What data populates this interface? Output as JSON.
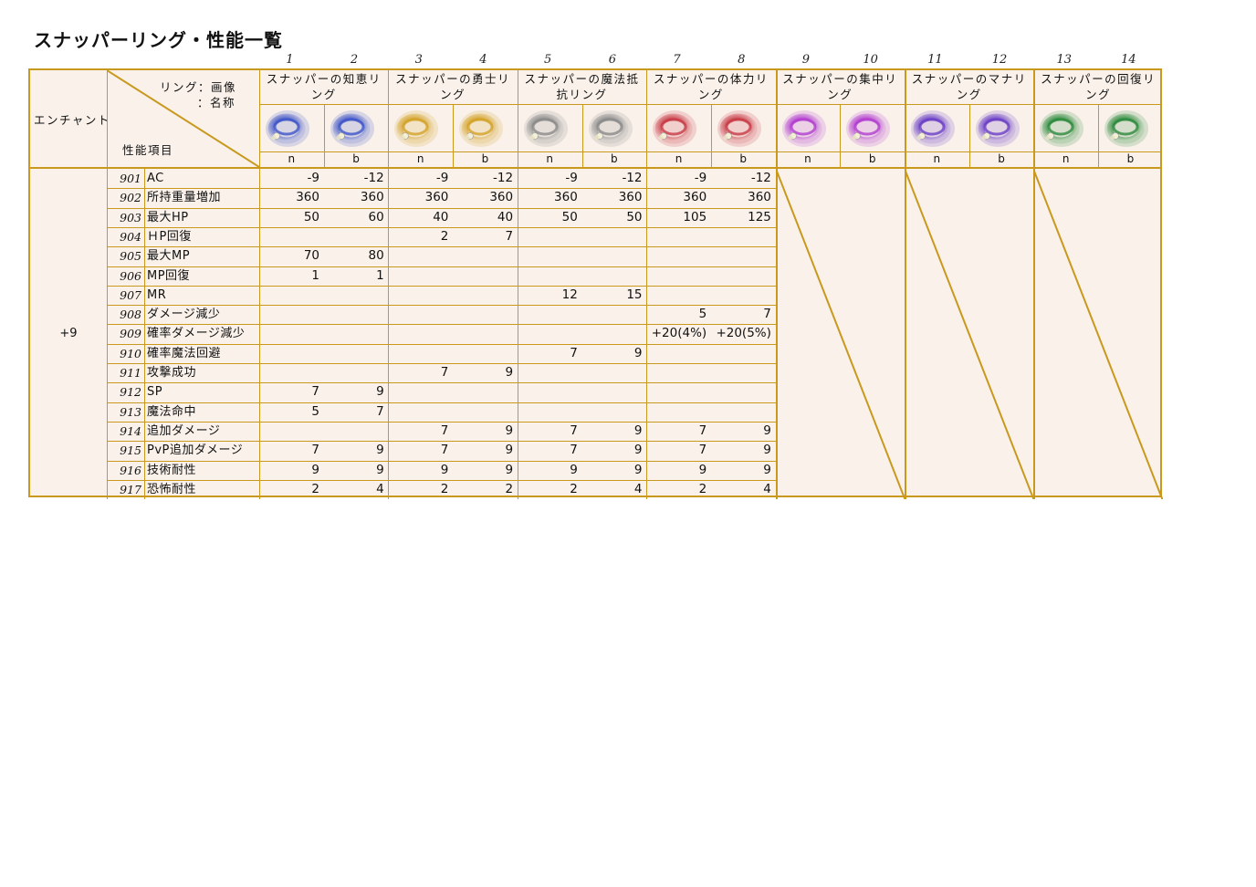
{
  "title": "スナッパーリング・性能一覧",
  "column_numbers": [
    "1",
    "2",
    "3",
    "4",
    "5",
    "6",
    "7",
    "8",
    "9",
    "10",
    "11",
    "12",
    "13",
    "14"
  ],
  "header": {
    "enchant_label": "エンチャント",
    "ring_label": "リング：画像",
    "name_label": "：名称",
    "item_label": "性能項目"
  },
  "rings": [
    {
      "name": "スナッパーの知恵リング",
      "color": "#3f55c8",
      "variants": [
        "n",
        "b"
      ]
    },
    {
      "name": "スナッパーの勇士リング",
      "color": "#d3a227",
      "variants": [
        "n",
        "b"
      ]
    },
    {
      "name": "スナッパーの魔法抵抗リング",
      "color": "#8a8a8a",
      "variants": [
        "n",
        "b"
      ]
    },
    {
      "name": "スナッパーの体力リング",
      "color": "#c83a46",
      "variants": [
        "n",
        "b"
      ]
    },
    {
      "name": "スナッパーの集中リング",
      "color": "#b23dd0",
      "variants": [
        "n",
        "b"
      ]
    },
    {
      "name": "スナッパーのマナリング",
      "color": "#6a3fc6",
      "variants": [
        "n",
        "b"
      ]
    },
    {
      "name": "スナッパーの回復リング",
      "color": "#2c8a3c",
      "variants": [
        "n",
        "b"
      ]
    }
  ],
  "enchant_value": "+9",
  "rows": [
    {
      "id": "901",
      "label": "AC",
      "values": [
        "-9",
        "-12",
        "-9",
        "-12",
        "-9",
        "-12",
        "-9",
        "-12"
      ]
    },
    {
      "id": "902",
      "label": "所持重量増加",
      "values": [
        "360",
        "360",
        "360",
        "360",
        "360",
        "360",
        "360",
        "360"
      ]
    },
    {
      "id": "903",
      "label": "最大HP",
      "values": [
        "50",
        "60",
        "40",
        "40",
        "50",
        "50",
        "105",
        "125"
      ]
    },
    {
      "id": "904",
      "label": "ＨP回復",
      "values": [
        "",
        "",
        "2",
        "7",
        "",
        "",
        "",
        ""
      ]
    },
    {
      "id": "905",
      "label": "最大MP",
      "values": [
        "70",
        "80",
        "",
        "",
        "",
        "",
        "",
        ""
      ]
    },
    {
      "id": "906",
      "label": "MP回復",
      "values": [
        "1",
        "1",
        "",
        "",
        "",
        "",
        "",
        ""
      ]
    },
    {
      "id": "907",
      "label": "MR",
      "values": [
        "",
        "",
        "",
        "",
        "12",
        "15",
        "",
        ""
      ]
    },
    {
      "id": "908",
      "label": "ダメージ減少",
      "values": [
        "",
        "",
        "",
        "",
        "",
        "",
        "5",
        "7"
      ]
    },
    {
      "id": "909",
      "label": "確率ダメージ減少",
      "values": [
        "",
        "",
        "",
        "",
        "",
        "",
        "+20(4%)",
        "+20(5%)"
      ]
    },
    {
      "id": "910",
      "label": "確率魔法回避",
      "values": [
        "",
        "",
        "",
        "",
        "7",
        "9",
        "",
        ""
      ]
    },
    {
      "id": "911",
      "label": "攻撃成功",
      "values": [
        "",
        "",
        "7",
        "9",
        "",
        "",
        "",
        ""
      ]
    },
    {
      "id": "912",
      "label": "SP",
      "values": [
        "7",
        "9",
        "",
        "",
        "",
        "",
        "",
        ""
      ]
    },
    {
      "id": "913",
      "label": "魔法命中",
      "values": [
        "5",
        "7",
        "",
        "",
        "",
        "",
        "",
        ""
      ]
    },
    {
      "id": "914",
      "label": "追加ダメージ",
      "values": [
        "",
        "",
        "7",
        "9",
        "7",
        "9",
        "7",
        "9"
      ]
    },
    {
      "id": "915",
      "label": "PvP追加ダメージ",
      "values": [
        "7",
        "9",
        "7",
        "9",
        "7",
        "9",
        "7",
        "9"
      ]
    },
    {
      "id": "916",
      "label": "技術耐性",
      "values": [
        "9",
        "9",
        "9",
        "9",
        "9",
        "9",
        "9",
        "9"
      ]
    },
    {
      "id": "917",
      "label": "恐怖耐性",
      "values": [
        "2",
        "4",
        "2",
        "2",
        "2",
        "4",
        "2",
        "4"
      ]
    }
  ]
}
